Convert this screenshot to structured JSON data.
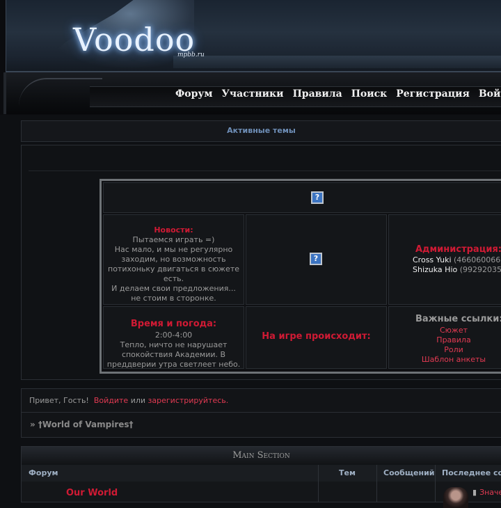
{
  "header": {
    "logo": "Voodoo",
    "logo_sub": "mpbb.ru",
    "nav": [
      "Форум",
      "Участники",
      "Правила",
      "Поиск",
      "Регистрация",
      "Войти"
    ]
  },
  "active_topics": {
    "title": "Активные темы"
  },
  "announcement": {
    "news": {
      "heading": "Новости:",
      "text": "Пытаемся играть =)\nНас мало, и мы не регулярно заходим, но возможность потихоньку двигаться в сюжете есть.\nИ делаем свои предложения... не стоим в сторонке."
    },
    "admin": {
      "heading": "Администрация:",
      "people": [
        {
          "name": "Cross Yuki",
          "contact": "(466060066"
        },
        {
          "name": "Shizuka Hio",
          "contact": "(99292035"
        }
      ]
    },
    "weather": {
      "heading": "Время и погода:",
      "time": "2:00-4:00",
      "text": "Тепло, ничто не нарушает спокойствия Академии. В преддверии утра светлеет небо."
    },
    "ongoing": {
      "heading": "На игре происходит:"
    },
    "links": {
      "heading": "Важные ссылки:",
      "items": [
        "Сюжет",
        "Правила",
        "Роли",
        "Шаблон анкеты"
      ]
    },
    "icon": "broken-image-icon"
  },
  "greeting": {
    "prefix": "Привет, Гость!",
    "login": "Войдите",
    "or": "или",
    "register": "зарегистрируйтесь."
  },
  "breadcrumb": "» †World of Vampires†",
  "forum_table": {
    "category": "Main Section",
    "columns": [
      "Форум",
      "Тем",
      "Сообщений",
      "Последнее соо"
    ],
    "rows": [
      {
        "name": "Our World",
        "last_post": "Значе"
      }
    ]
  },
  "colors": {
    "accent_red": "#d01a34",
    "link_pink": "#e23a52",
    "header_blue": "#6f8fb8"
  }
}
